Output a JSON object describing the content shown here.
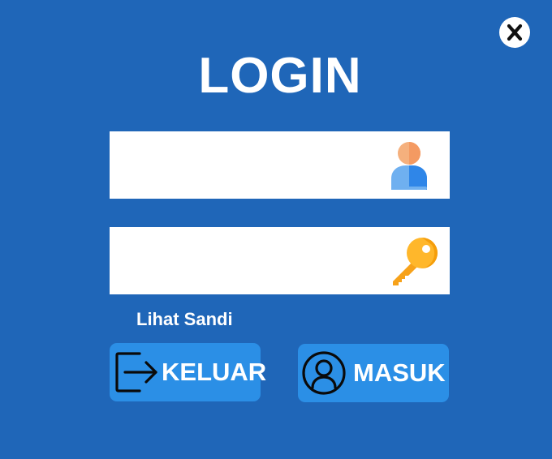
{
  "title": "LOGIN",
  "close_button": {
    "glyph": "X",
    "icon": "close-icon"
  },
  "username_field": {
    "value": "",
    "placeholder": "",
    "icon": "user-icon"
  },
  "password_field": {
    "value": "",
    "placeholder": "",
    "icon": "key-icon"
  },
  "show_password_label": "Lihat Sandi",
  "buttons": {
    "exit_label": "KELUAR",
    "exit_icon": "logout-icon",
    "login_label": "MASUK",
    "login_icon": "account-circle-icon"
  },
  "colors": {
    "background": "#1f66b8",
    "button": "#2b8fe6",
    "field": "#ffffff",
    "text": "#ffffff"
  }
}
